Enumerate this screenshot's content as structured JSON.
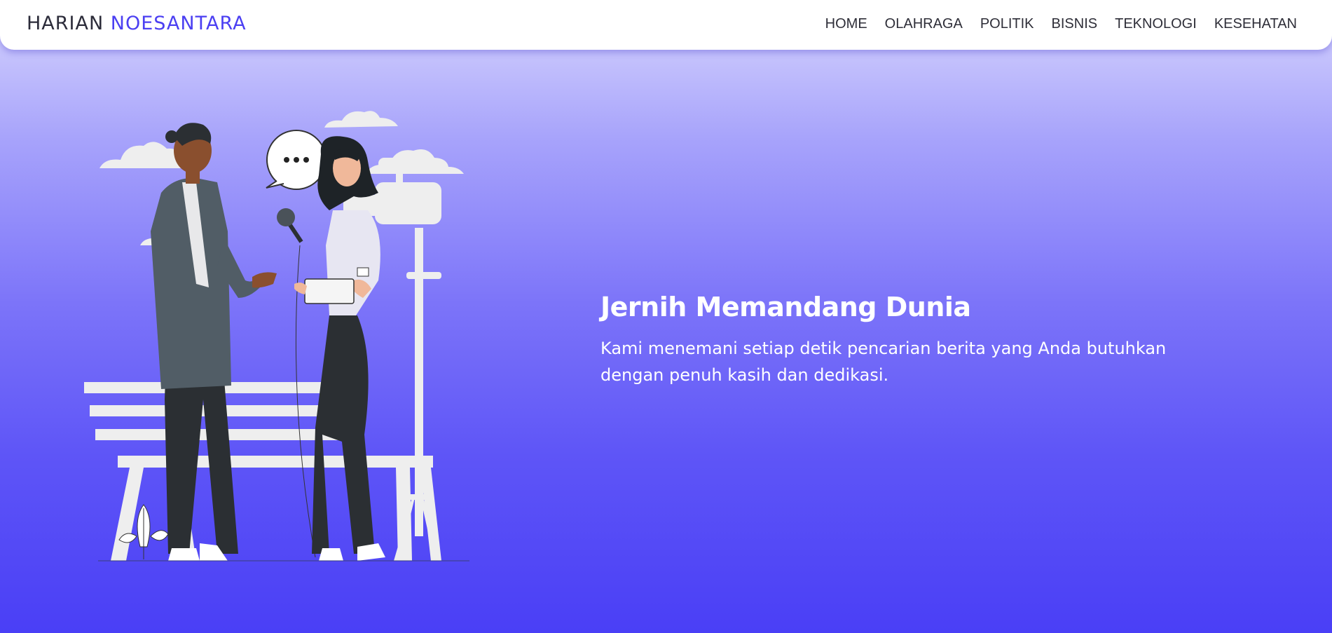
{
  "brand": {
    "part1": "HARIAN",
    "part2": "NOESANTARA"
  },
  "nav": {
    "items": [
      "HOME",
      "OLAHRAGA",
      "POLITIK",
      "BISNIS",
      "TEKNOLOGI",
      "KESEHATAN"
    ]
  },
  "hero": {
    "title": "Jernih Memandang Dunia",
    "subtitle": "Kami menemani setiap detik pencarian berita yang Anda butuhkan dengan penuh kasih dan dedikasi.",
    "speech_bubble": "..."
  },
  "colors": {
    "accent": "#4b3ff2",
    "bg_top": "#d8d6fd",
    "bg_bottom": "#4a3ff6"
  }
}
